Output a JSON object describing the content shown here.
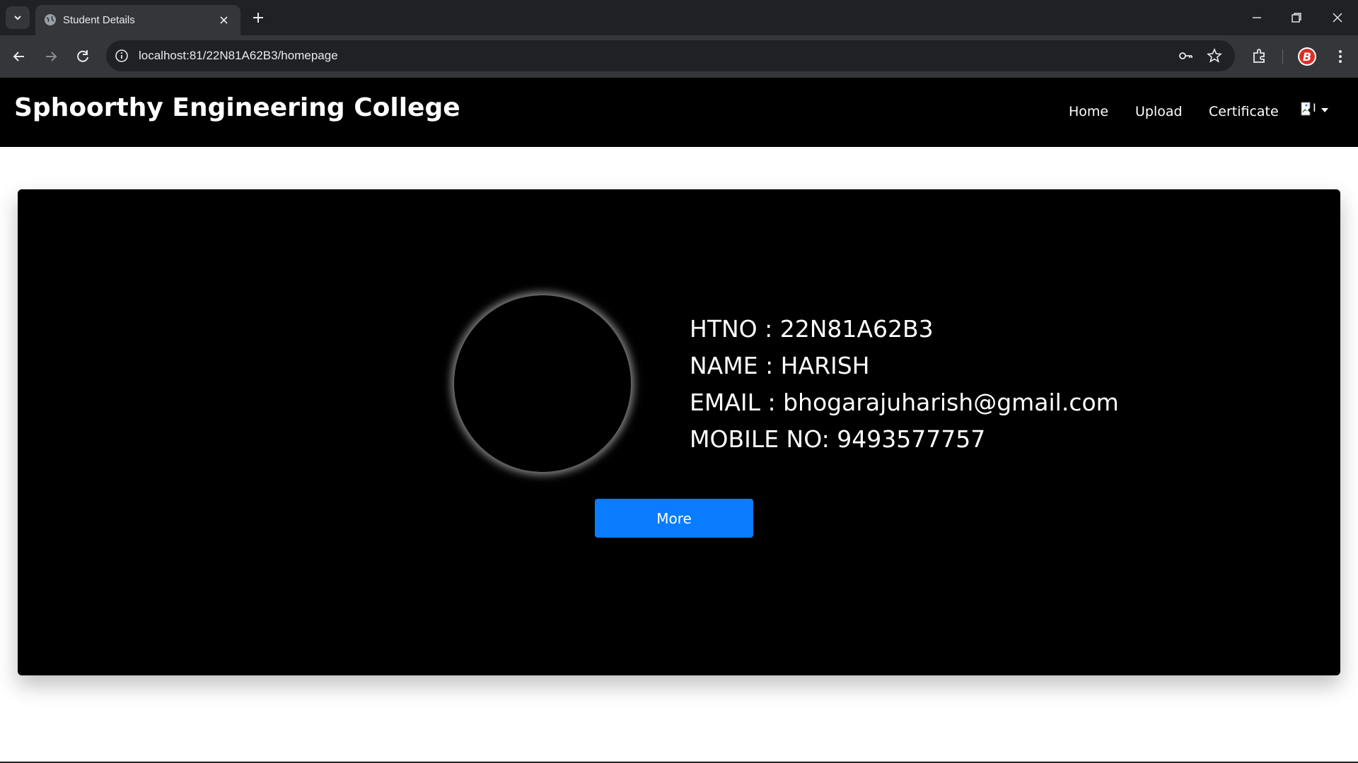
{
  "browser": {
    "tab_title": "Student Details",
    "url": "localhost:81/22N81A62B3/homepage",
    "icons": {
      "tab_search": "chevron-down-icon",
      "tab_favicon": "globe-icon",
      "tab_close": "close-icon",
      "new_tab": "plus-icon",
      "back": "arrow-left-icon",
      "forward": "arrow-right-icon",
      "reload": "reload-icon",
      "site_info": "info-icon",
      "password": "key-icon",
      "bookmark": "star-icon",
      "extensions": "puzzle-icon",
      "profile": "profile-icon",
      "menu": "kebab-menu-icon"
    }
  },
  "navbar": {
    "brand": "Sphoorthy Engineering College",
    "links": [
      "Home",
      "Upload",
      "Certificate"
    ],
    "profile_alt": "I"
  },
  "student": {
    "htno": "HTNO : 22N81A62B3",
    "name": "NAME : HARISH",
    "email": "EMAIL : bhogarajuharish@gmail.com",
    "mobile": "MOBILE NO: 9493577757"
  },
  "actions": {
    "more_label": "More"
  },
  "colors": {
    "navbar_bg": "#000000",
    "card_bg": "#000000",
    "button_bg": "#0a7cff",
    "chrome_dark": "#202124",
    "chrome_toolbar": "#35363a"
  }
}
